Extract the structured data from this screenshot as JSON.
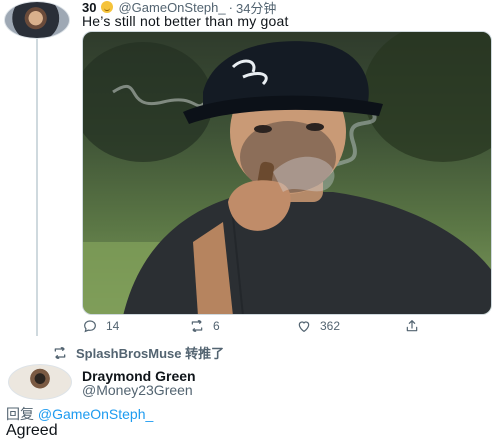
{
  "tweet": {
    "name": "30",
    "handle": "@GameOnSteph_",
    "separator": "·",
    "time": "34分钟",
    "text": "He’s still not better than my goat",
    "actions": {
      "replies": "14",
      "retweets": "6",
      "likes": "362"
    }
  },
  "retweet_notice": {
    "text": "SplashBrosMuse 转推了"
  },
  "reply": {
    "name": "Draymond Green",
    "handle": "@Money23Green",
    "reply_label": "回复",
    "reply_mention": "@GameOnSteph_",
    "text": "Agreed"
  },
  "colors": {
    "text_primary": "#0f1419",
    "text_secondary": "#536471",
    "link": "#1d9bf0",
    "border": "#cfd9de"
  },
  "icons": {
    "reply": "reply-icon",
    "retweet": "retweet-icon",
    "like": "heart-icon",
    "share": "share-icon"
  }
}
